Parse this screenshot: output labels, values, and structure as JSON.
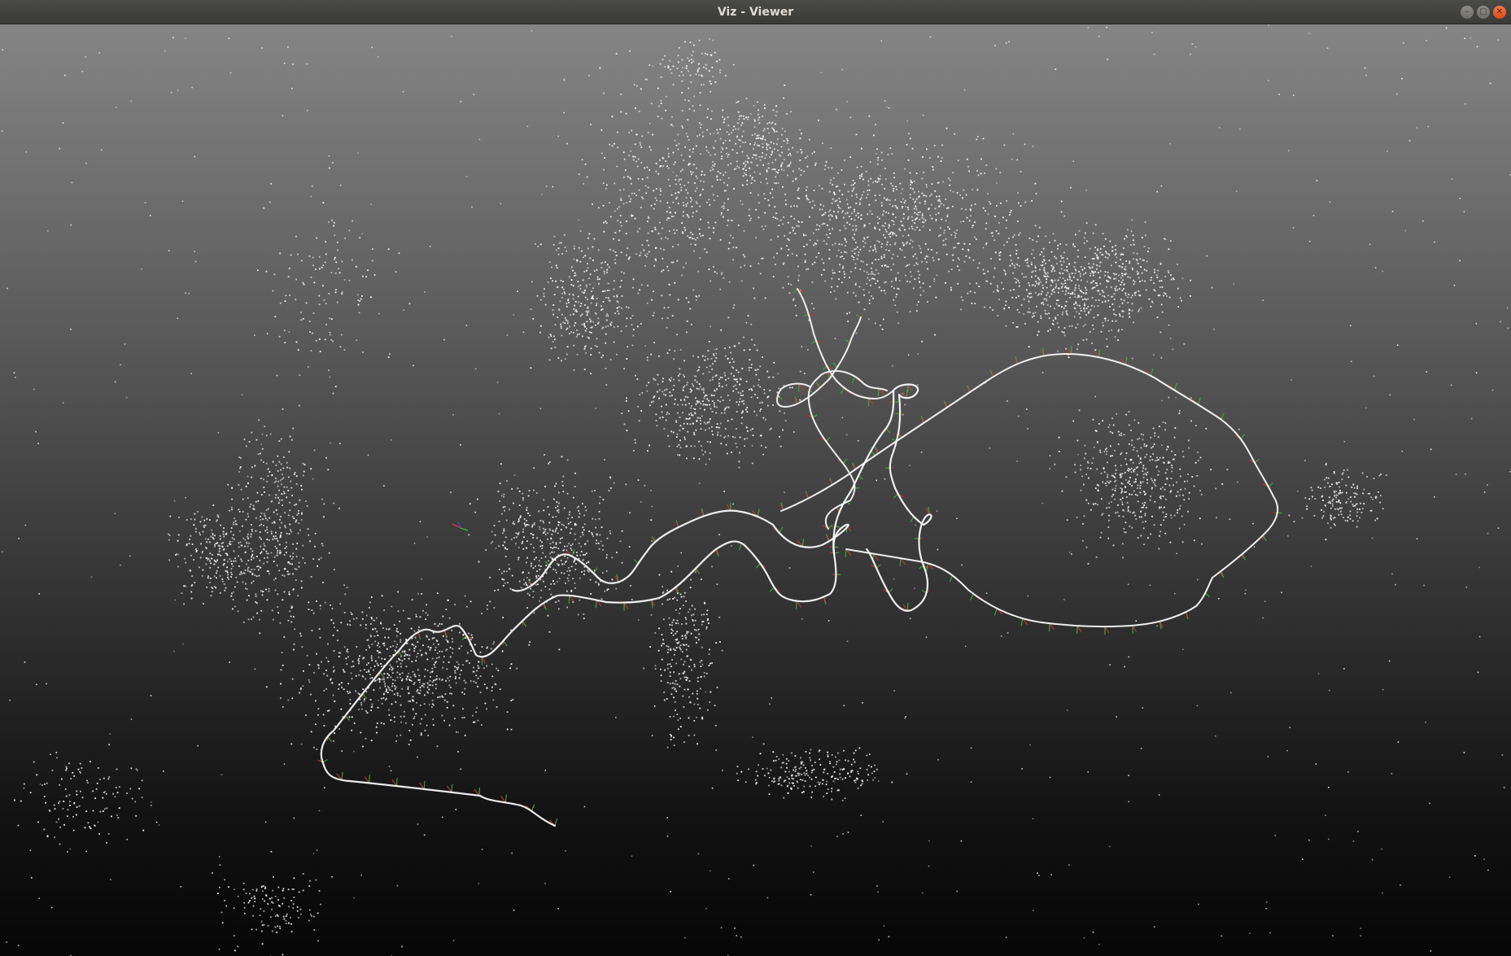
{
  "window": {
    "title": "Viz - Viewer",
    "controls": [
      {
        "name": "minimize",
        "glyph": "–"
      },
      {
        "name": "maximize",
        "glyph": "□"
      },
      {
        "name": "close",
        "glyph": "✕"
      }
    ]
  },
  "viewport": {
    "background_top": "#858585",
    "background_bottom": "#060606",
    "point_color": "#ffffff",
    "trajectory_color": "#ffffff",
    "axis_colors": {
      "x": "#e0303a",
      "y": "#2fbf3a",
      "z": "#3a4fd8"
    }
  }
}
